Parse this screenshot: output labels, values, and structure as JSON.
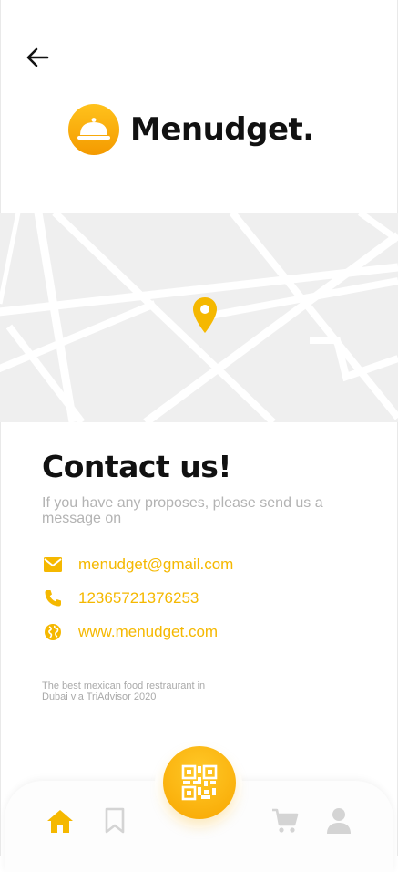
{
  "brand": {
    "name": "Menudget",
    "dot": ".",
    "colors": {
      "accent": "#f5b800",
      "text": "#111111",
      "muted": "#b3b3b3"
    }
  },
  "header": {
    "back_icon": "arrow-left-icon"
  },
  "map": {
    "pin_icon": "location-pin-icon",
    "pin_color": "#f5b800"
  },
  "contact": {
    "title": "Contact us!",
    "subtitle": "If you have any proposes, please send us a message on",
    "items": [
      {
        "icon": "mail-icon",
        "value": "menudget@gmail.com"
      },
      {
        "icon": "phone-icon",
        "value": "12365721376253"
      },
      {
        "icon": "globe-icon",
        "value": "www.menudget.com"
      }
    ],
    "footnote": "The best mexican food restraurant in Dubai via TriAdvisor 2020"
  },
  "bottom_nav": {
    "items": [
      {
        "icon": "home-icon",
        "active": true
      },
      {
        "icon": "bookmark-icon",
        "active": false
      },
      {
        "icon": "qr-code-icon",
        "active": false
      },
      {
        "icon": "cart-icon",
        "active": false
      },
      {
        "icon": "user-icon",
        "active": false
      }
    ],
    "active_color": "#f5b800",
    "inactive_color": "#d4d4d4"
  }
}
